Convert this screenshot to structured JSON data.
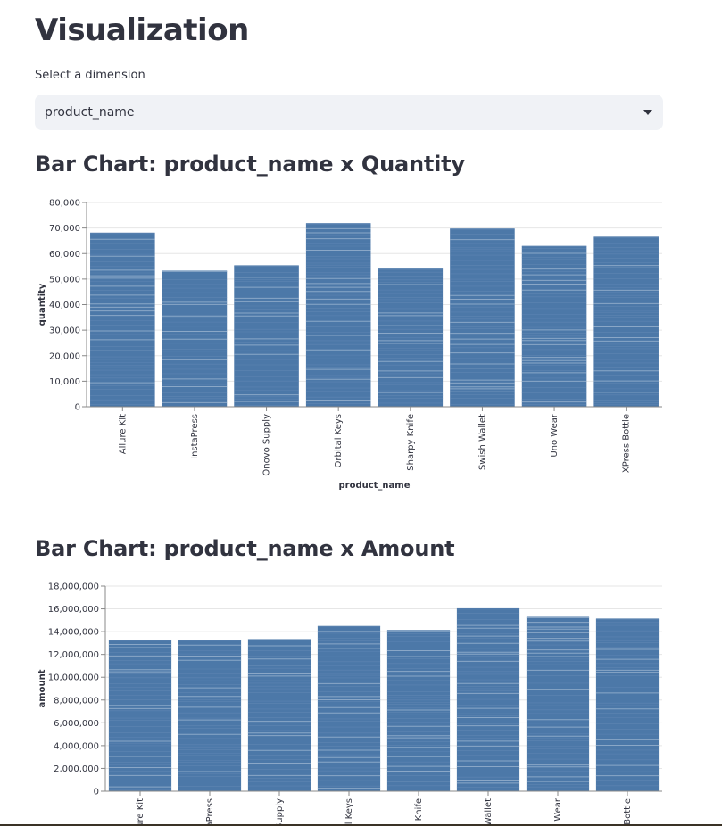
{
  "page": {
    "title": "Visualization"
  },
  "selector": {
    "label": "Select a dimension",
    "value": "product_name"
  },
  "charts": [
    {
      "heading": "Bar Chart: product_name x Quantity"
    },
    {
      "heading": "Bar Chart: product_name x Amount"
    }
  ],
  "chart_data": [
    {
      "type": "bar",
      "title": "Bar Chart: product_name x Quantity",
      "xlabel": "product_name",
      "ylabel": "quantity",
      "categories": [
        "Allure Kit",
        "InstaPress",
        "Onovo Supply",
        "Orbital Keys",
        "Sharpy Knife",
        "Swish Wallet",
        "Uno Wear",
        "XPress Bottle"
      ],
      "values": [
        68200,
        53300,
        55400,
        71900,
        54100,
        69800,
        63000,
        66600
      ],
      "ylim": [
        0,
        80000
      ],
      "yticks": [
        0,
        10000,
        20000,
        30000,
        40000,
        50000,
        60000,
        70000,
        80000
      ],
      "ytick_labels": [
        "0",
        "10,000",
        "20,000",
        "30,000",
        "40,000",
        "50,000",
        "60,000",
        "70,000",
        "80,000"
      ],
      "grid": true,
      "color": "#4c78a8"
    },
    {
      "type": "bar",
      "title": "Bar Chart: product_name x Amount",
      "xlabel": "",
      "ylabel": "amount",
      "categories": [
        "Allure Kit",
        "InstaPress",
        "Onovo Supply",
        "Orbital Keys",
        "Sharpy Knife",
        "Swish Wallet",
        "Uno Wear",
        "XPress Bottle"
      ],
      "values": [
        13300000,
        13300000,
        13350000,
        14500000,
        14150000,
        16050000,
        15300000,
        15150000
      ],
      "ylim": [
        0,
        18000000
      ],
      "yticks": [
        0,
        2000000,
        4000000,
        6000000,
        8000000,
        10000000,
        12000000,
        14000000,
        16000000,
        18000000
      ],
      "ytick_labels": [
        "0",
        "2,000,000",
        "4,000,000",
        "6,000,000",
        "8,000,000",
        "10,000,000",
        "12,000,000",
        "14,000,000",
        "16,000,000",
        "18,000,000"
      ],
      "grid": true,
      "color": "#4c78a8"
    }
  ]
}
